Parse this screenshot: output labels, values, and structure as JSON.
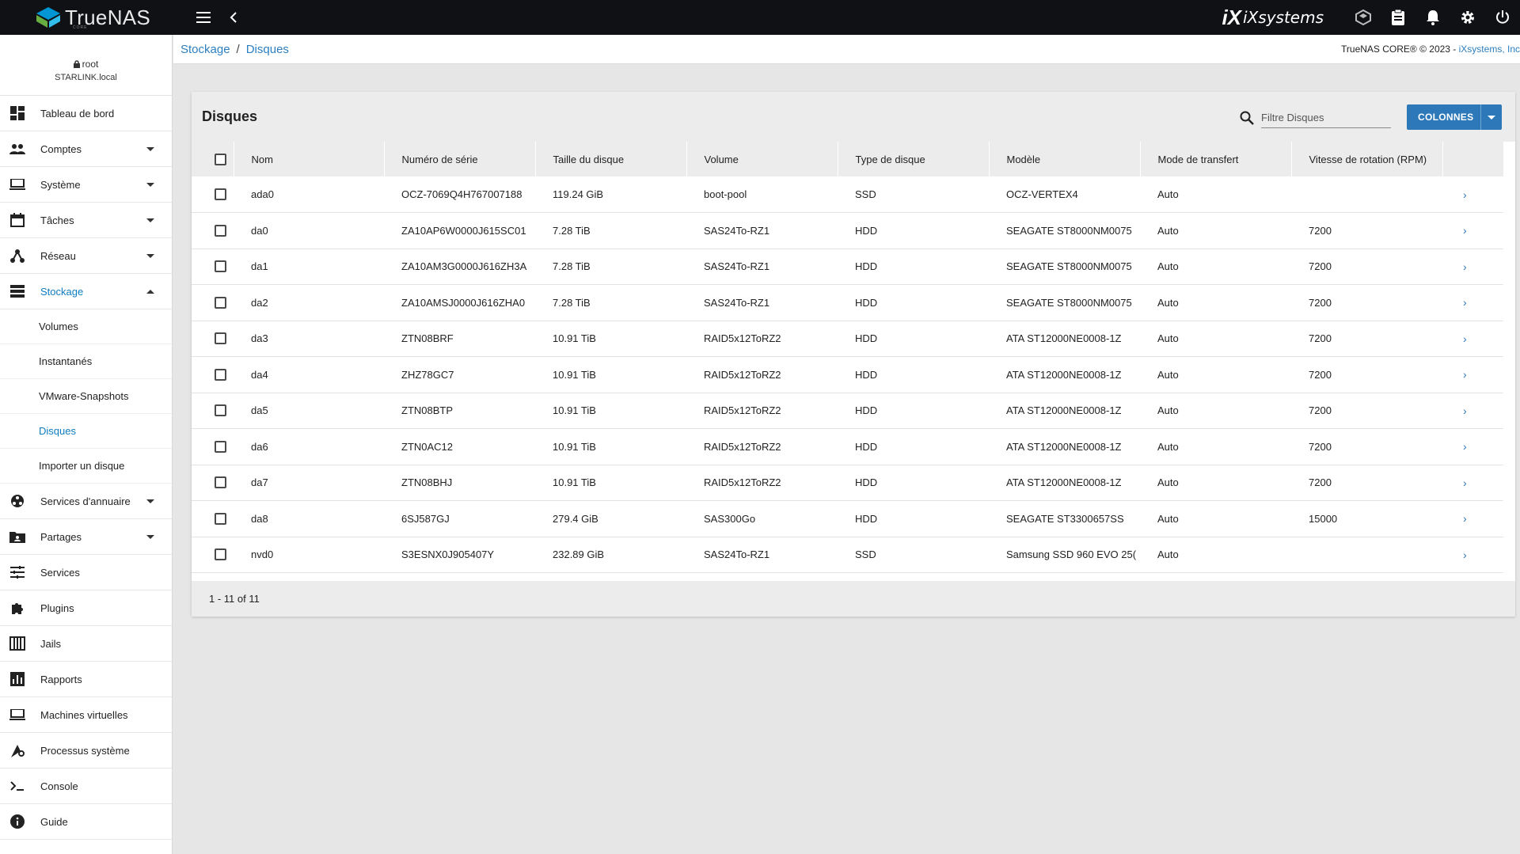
{
  "app": {
    "brand": "TrueNAS",
    "brand_sub": "CORE",
    "vendor_logo": "iXsystems"
  },
  "user": {
    "name": "root",
    "host": "STARLINK.local"
  },
  "nav": {
    "items": [
      {
        "label": "Tableau de bord",
        "icon": "dashboard-icon"
      },
      {
        "label": "Comptes",
        "icon": "people-icon",
        "expandable": true
      },
      {
        "label": "Système",
        "icon": "laptop-icon",
        "expandable": true
      },
      {
        "label": "Tâches",
        "icon": "calendar-icon",
        "expandable": true
      },
      {
        "label": "Réseau",
        "icon": "network-icon",
        "expandable": true
      },
      {
        "label": "Stockage",
        "icon": "storage-icon",
        "expandable": true,
        "expanded": true,
        "active": true
      }
    ],
    "sub_items": [
      {
        "label": "Volumes"
      },
      {
        "label": "Instantanés"
      },
      {
        "label": "VMware-Snapshots"
      },
      {
        "label": "Disques",
        "active": true
      },
      {
        "label": "Importer un disque"
      }
    ],
    "items_after": [
      {
        "label": "Services d'annuaire",
        "icon": "directory-icon",
        "expandable": true
      },
      {
        "label": "Partages",
        "icon": "folder-share-icon",
        "expandable": true
      },
      {
        "label": "Services",
        "icon": "tune-icon"
      },
      {
        "label": "Plugins",
        "icon": "puzzle-icon"
      },
      {
        "label": "Jails",
        "icon": "jail-icon"
      },
      {
        "label": "Rapports",
        "icon": "bar-chart-icon"
      },
      {
        "label": "Machines virtuelles",
        "icon": "computer-icon"
      },
      {
        "label": "Processus système",
        "icon": "shell-process-icon"
      },
      {
        "label": "Console",
        "icon": "terminal-icon"
      },
      {
        "label": "Guide",
        "icon": "info-icon"
      }
    ]
  },
  "breadcrumb": {
    "parent": "Stockage",
    "current": "Disques",
    "separator": "/"
  },
  "copyright": {
    "text": "TrueNAS CORE® © 2023 - ",
    "link": "iXsystems, Inc"
  },
  "card": {
    "title": "Disques",
    "filter_placeholder": "Filtre Disques",
    "columns_button": "COLONNES",
    "footer": "1 - 11 of 11"
  },
  "table": {
    "headers": [
      "Nom",
      "Numéro de série",
      "Taille du disque",
      "Volume",
      "Type de disque",
      "Modèle",
      "Mode de transfert",
      "Vitesse de rotation (RPM)"
    ],
    "rows": [
      [
        "ada0",
        "OCZ-7069Q4H767007188",
        "119.24 GiB",
        "boot-pool",
        "SSD",
        "OCZ-VERTEX4",
        "Auto",
        ""
      ],
      [
        "da0",
        "ZA10AP6W0000J615SC01",
        "7.28 TiB",
        "SAS24To-RZ1",
        "HDD",
        "SEAGATE ST8000NM0075",
        "Auto",
        "7200"
      ],
      [
        "da1",
        "ZA10AM3G0000J616ZH3A",
        "7.28 TiB",
        "SAS24To-RZ1",
        "HDD",
        "SEAGATE ST8000NM0075",
        "Auto",
        "7200"
      ],
      [
        "da2",
        "ZA10AMSJ0000J616ZHA0",
        "7.28 TiB",
        "SAS24To-RZ1",
        "HDD",
        "SEAGATE ST8000NM0075",
        "Auto",
        "7200"
      ],
      [
        "da3",
        "ZTN08BRF",
        "10.91 TiB",
        "RAID5x12ToRZ2",
        "HDD",
        "ATA ST12000NE0008-1Z",
        "Auto",
        "7200"
      ],
      [
        "da4",
        "ZHZ78GC7",
        "10.91 TiB",
        "RAID5x12ToRZ2",
        "HDD",
        "ATA ST12000NE0008-1Z",
        "Auto",
        "7200"
      ],
      [
        "da5",
        "ZTN08BTP",
        "10.91 TiB",
        "RAID5x12ToRZ2",
        "HDD",
        "ATA ST12000NE0008-1Z",
        "Auto",
        "7200"
      ],
      [
        "da6",
        "ZTN0AC12",
        "10.91 TiB",
        "RAID5x12ToRZ2",
        "HDD",
        "ATA ST12000NE0008-1Z",
        "Auto",
        "7200"
      ],
      [
        "da7",
        "ZTN08BHJ",
        "10.91 TiB",
        "RAID5x12ToRZ2",
        "HDD",
        "ATA ST12000NE0008-1Z",
        "Auto",
        "7200"
      ],
      [
        "da8",
        "6SJ587GJ",
        "279.4 GiB",
        "SAS300Go",
        "HDD",
        "SEAGATE ST3300657SS",
        "Auto",
        "15000"
      ],
      [
        "nvd0",
        "S3ESNX0J905407Y",
        "232.89 GiB",
        "SAS24To-RZ1",
        "SSD",
        "Samsung SSD 960 EVO 25(",
        "Auto",
        ""
      ]
    ]
  },
  "colors": {
    "accent": "#2d78b8",
    "link": "#0e7cc1",
    "topbar": "#0f1115"
  }
}
